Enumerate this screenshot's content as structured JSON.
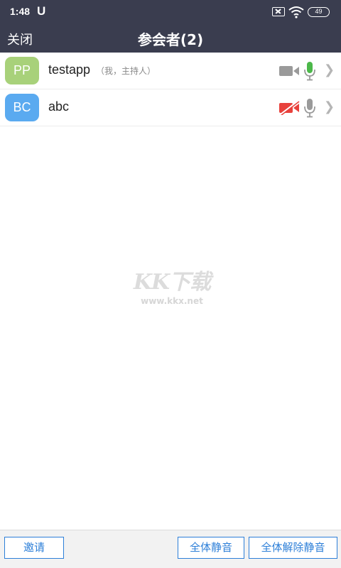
{
  "status_bar": {
    "time": "1:48",
    "app_icon_letter": "U",
    "battery": "49"
  },
  "header": {
    "close_label": "关闭",
    "title": "参会者(2)"
  },
  "participants": [
    {
      "initials": "PP",
      "name": "testapp",
      "tag": "（我，主持人）",
      "avatar_color": "#a8d17a",
      "video": "off-gray",
      "mic": "on-green"
    },
    {
      "initials": "BC",
      "name": "abc",
      "tag": "",
      "avatar_color": "#5aaaf0",
      "video": "off-red",
      "mic": "on-gray"
    }
  ],
  "watermark": {
    "text": "KK下载",
    "url": "www.kkx.net"
  },
  "bottom_bar": {
    "invite_label": "邀请",
    "mute_all_label": "全体静音",
    "unmute_all_label": "全体解除静音"
  },
  "colors": {
    "header_bg": "#3a3d4f",
    "accent_blue": "#2d7fd8",
    "mic_green": "#4cb84a",
    "camera_red": "#e8413c"
  }
}
